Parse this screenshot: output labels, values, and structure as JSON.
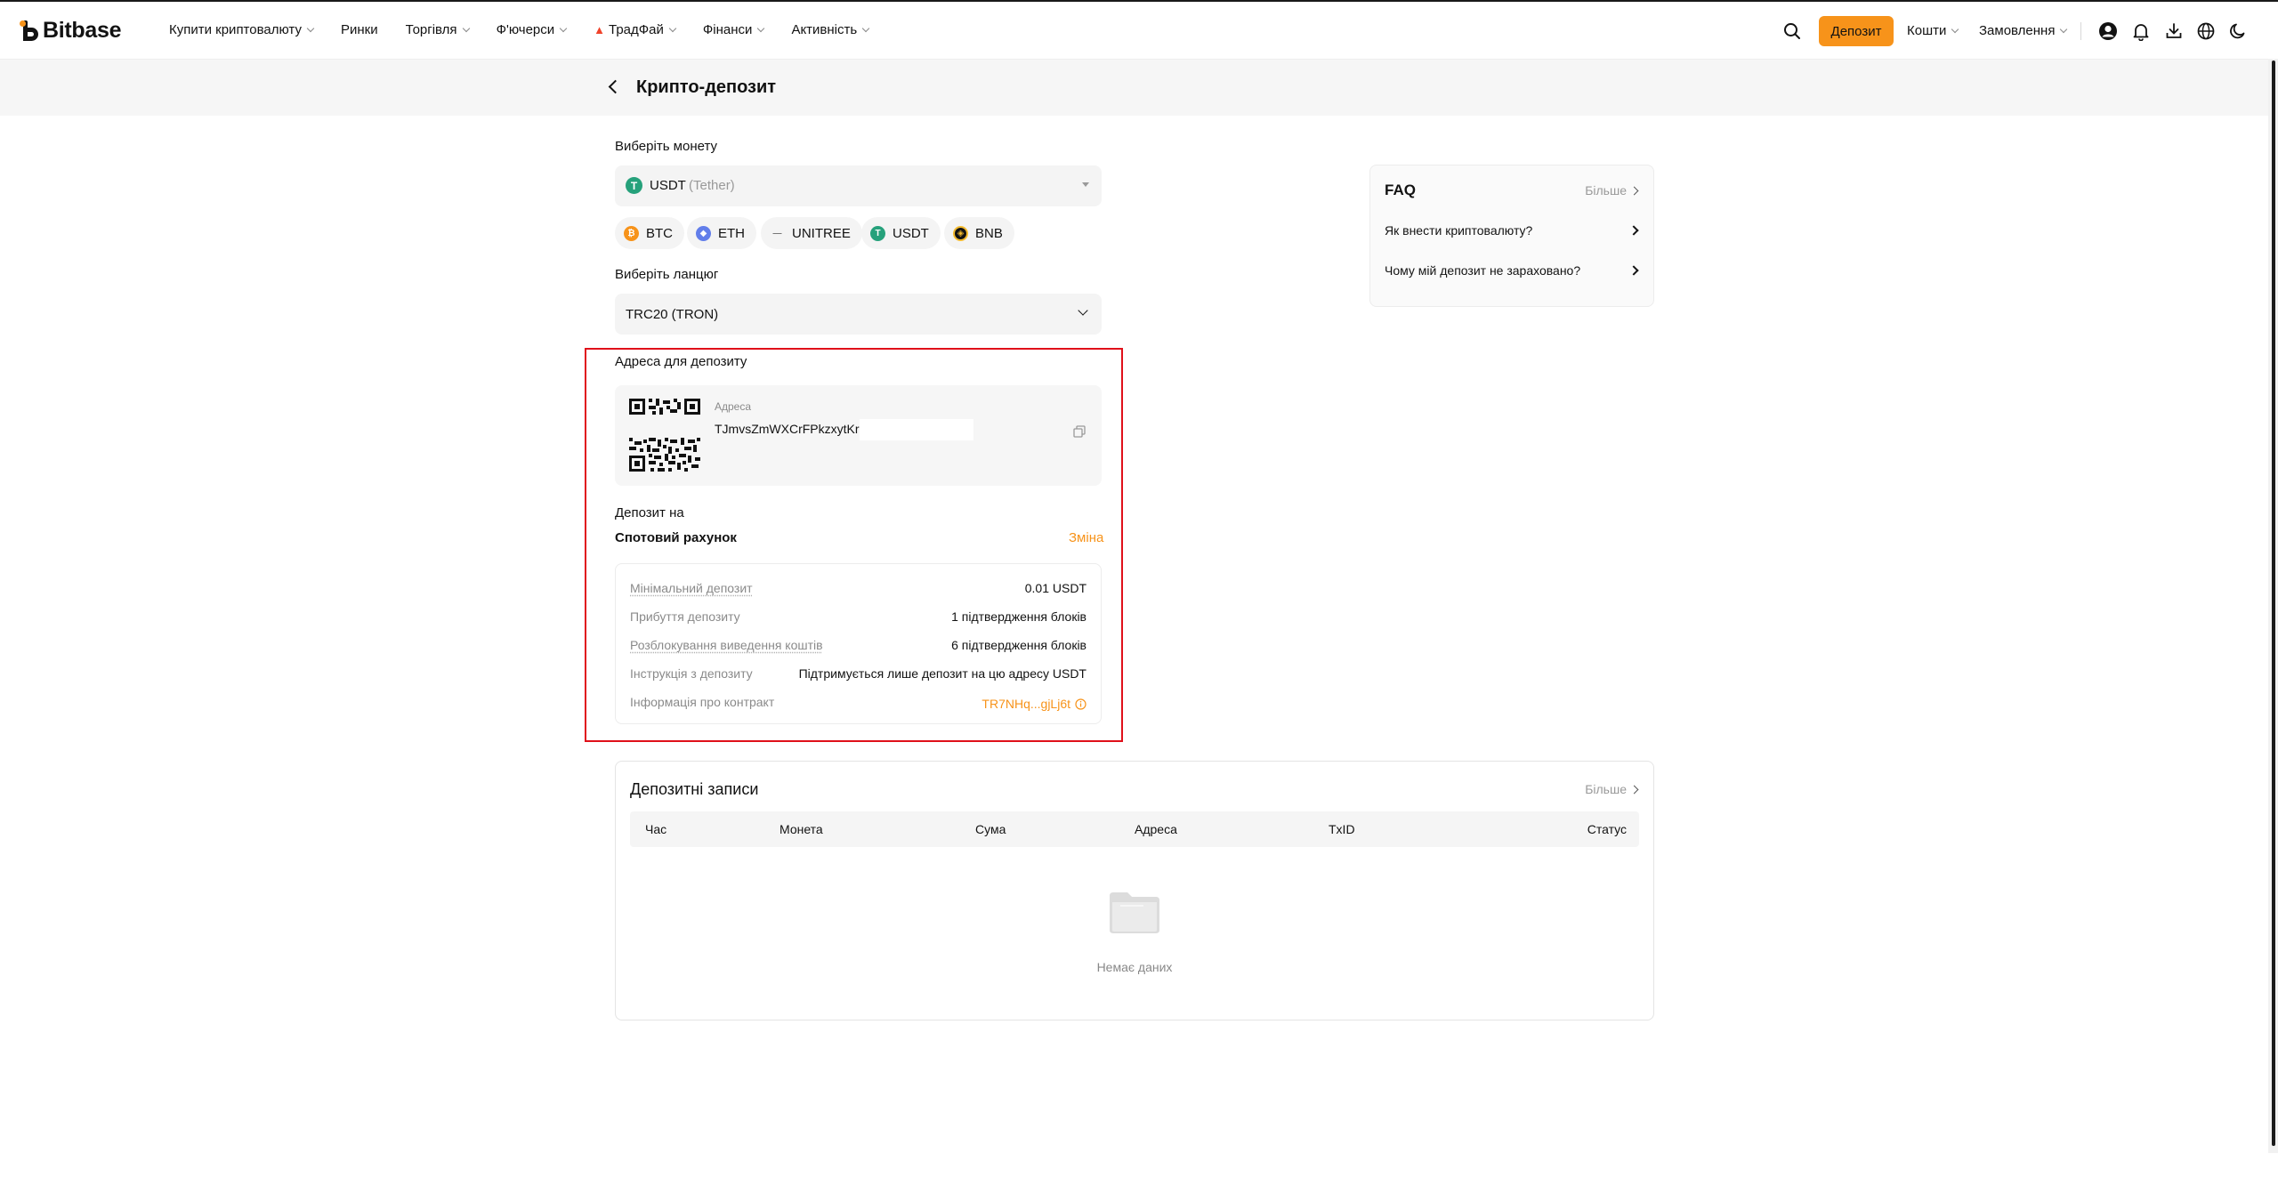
{
  "brand": {
    "name": "Bitbase",
    "accent": "#f7931a",
    "highlight": "#e0101a"
  },
  "nav": [
    {
      "label": "Купити криптовалюту",
      "caret": true
    },
    {
      "label": "Ринки",
      "caret": false
    },
    {
      "label": "Торгівля",
      "caret": true
    },
    {
      "label": "Ф'ючерси",
      "caret": true
    },
    {
      "label": "ТрадФай",
      "caret": true,
      "icon": "flame-icon"
    },
    {
      "label": "Фінанси",
      "caret": true
    },
    {
      "label": "Активність",
      "caret": true
    }
  ],
  "header_right": {
    "deposit_label": "Депозит",
    "funds_label": "Кошти",
    "orders_label": "Замовлення",
    "icons": [
      "search-icon",
      "user-icon",
      "bell-icon",
      "download-icon",
      "globe-icon",
      "moon-icon"
    ]
  },
  "page": {
    "title": "Крипто-депозит"
  },
  "coin_select": {
    "label": "Виберіть монету",
    "symbol": "USDT",
    "name": "(Tether)",
    "quick_coins": [
      "BTC",
      "ETH",
      "UNITREE",
      "USDT",
      "BNB"
    ]
  },
  "chain_select": {
    "label": "Виберіть ланцюг",
    "value": "TRC20 (TRON)"
  },
  "address": {
    "section_label": "Адреса для депозиту",
    "caption": "Адреса",
    "value": "TJmvsZmWXCrFPkzxytKr"
  },
  "deposit_to": {
    "label": "Депозит на",
    "account": "Спотовий рахунок",
    "change_label": "Зміна"
  },
  "info": [
    {
      "key": "Мінімальний депозит",
      "value": "0.01 USDT"
    },
    {
      "key": "Прибуття депозиту",
      "value": "1 підтвердження блоків"
    },
    {
      "key": "Розблокування виведення коштів",
      "value": "6 підтвердження блоків"
    },
    {
      "key": "Інструкція з депозиту",
      "value": "Підтримується лише депозит на цю адресу USDT"
    },
    {
      "key": "Інформація про контракт",
      "value": "TR7NHq...gjLj6t"
    }
  ],
  "faq": {
    "title": "FAQ",
    "more_label": "Більше",
    "items": [
      "Як внести криптовалюту?",
      "Чому мій депозит не зараховано?"
    ]
  },
  "records": {
    "title": "Депозитні записи",
    "more_label": "Більше",
    "columns": [
      "Час",
      "Монета",
      "Сума",
      "Адреса",
      "TxID",
      "Статус"
    ],
    "empty_text": "Немає даних"
  }
}
